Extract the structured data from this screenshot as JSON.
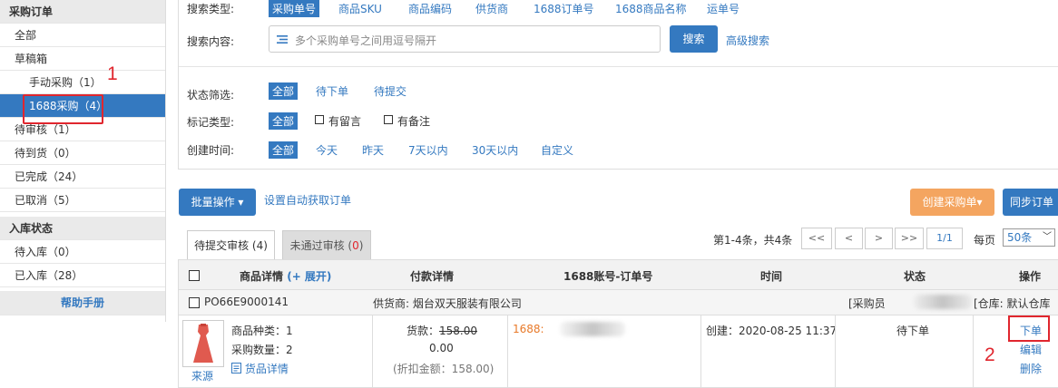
{
  "sidebar": {
    "purchase_header": "采购订单",
    "items": [
      {
        "label": "全部"
      },
      {
        "label": "草稿箱"
      },
      {
        "label": "手动采购（1）"
      },
      {
        "label": "1688采购（4）"
      },
      {
        "label": "待审核（1）"
      },
      {
        "label": "待到货（0）"
      },
      {
        "label": "已完成（24）"
      },
      {
        "label": "已取消（5）"
      }
    ],
    "stock_header": "入库状态",
    "stock_items": [
      {
        "label": "待入库（0）"
      },
      {
        "label": "已入库（28）"
      }
    ],
    "help": "帮助手册"
  },
  "annotations": {
    "one": "1",
    "two": "2"
  },
  "filter": {
    "search_type_label": "搜索类型:",
    "search_types": [
      "采购单号",
      "商品SKU",
      "商品编码",
      "供货商",
      "1688订单号",
      "1688商品名称",
      "运单号"
    ],
    "search_content_label": "搜索内容:",
    "search_placeholder": "多个采购单号之间用逗号隔开",
    "search_button": "搜索",
    "advanced_search": "高级搜索",
    "status_label": "状态筛选:",
    "status_options": [
      "全部",
      "待下单",
      "待提交"
    ],
    "mark_label": "标记类型:",
    "mark_all": "全部",
    "mark_options": [
      "有留言",
      "有备注"
    ],
    "created_label": "创建时间:",
    "created_options": [
      "全部",
      "今天",
      "昨天",
      "7天以内",
      "30天以内",
      "自定义"
    ]
  },
  "toolbar": {
    "batch": "批量操作 ▾",
    "auto_fetch": "设置自动获取订单",
    "create_purchase": "创建采购单▾",
    "sync": "同步订单"
  },
  "tabs": [
    {
      "label": "待提交审核 (4)"
    },
    {
      "label_prefix": "未通过审核 (",
      "count": "0",
      "label_suffix": ")"
    }
  ],
  "pager": {
    "summary": "第1-4条，共4条",
    "first": "<<",
    "prev": "<",
    "next": ">",
    "last": ">>",
    "page": "1/1",
    "per_page_label": "每页",
    "per_page_value": "50条"
  },
  "table": {
    "columns": {
      "product_prefix": "商品详情",
      "product_expand": "(+ 展开)",
      "payment": "付款详情",
      "account": "1688账号-订单号",
      "time": "时间",
      "status": "状态",
      "actions": "操作"
    },
    "order": {
      "po": "PO66E9000141",
      "supplier": "供货商:  烟台双天服装有限公司",
      "buyer_prefix": "[采购员",
      "warehouse": "[仓库: 默认仓库"
    },
    "row": {
      "source": "来源",
      "kinds": "商品种类：1",
      "qty": "采购数量：2",
      "goods_detail": "货品详情",
      "payment_goods": "货款：",
      "payment_goods_value": "158.00",
      "payment_total": "0.00",
      "payment_discount": "(折扣金额：158.00)",
      "account_prefix": "1688:",
      "created": "创建：2020-08-25 11:37",
      "status": "待下单",
      "action_order": "下单",
      "action_edit": "编辑",
      "action_delete": "删除"
    }
  },
  "colors": {
    "accent": "#3479c0",
    "orange": "#f4a560",
    "annotation": "#e0262e"
  }
}
